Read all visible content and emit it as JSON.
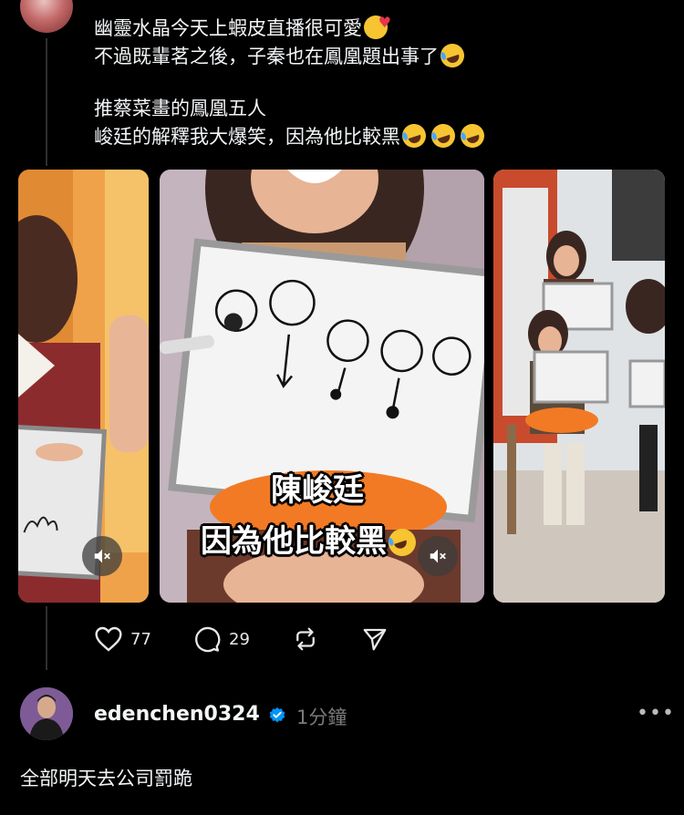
{
  "post": {
    "lines": [
      "幽靈水晶今天上蝦皮直播很可愛",
      "不過既輩茗之後，子秦也在鳳凰題出事了",
      "推蔡菜畫的鳳凰五人",
      "峻廷的解釋我大爆笑，因為他比較黑"
    ]
  },
  "media": {
    "caption_line1": "陳峻廷",
    "caption_line2": "因為他比較黑"
  },
  "actions": {
    "likes": "77",
    "comments": "29"
  },
  "reply": {
    "username": "edenchen0324",
    "time": "1分鐘",
    "text": "全部明天去公司罰跪"
  },
  "icons": {
    "like": "heart-icon",
    "comment": "comment-bubble-icon",
    "repost": "repost-icon",
    "share": "send-icon",
    "mute": "speaker-muted-icon",
    "verified": "verified-badge-icon",
    "more": "more-dots-icon"
  },
  "colors": {
    "background": "#000000",
    "text": "#f3f5f7",
    "muted": "#7a7a7a",
    "verified": "#0095f6"
  }
}
